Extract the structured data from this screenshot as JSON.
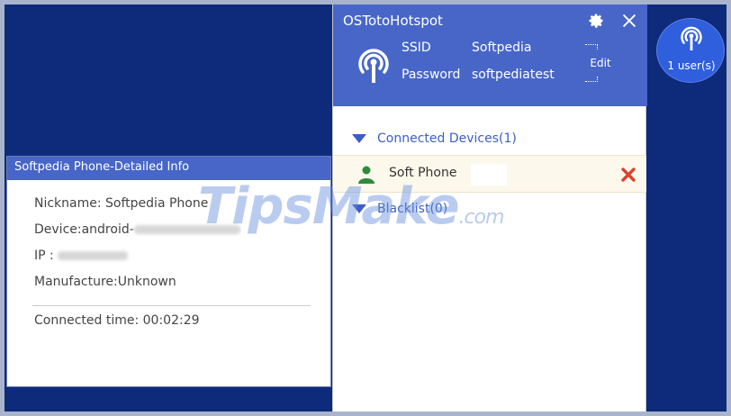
{
  "hotspot": {
    "title": "OSTotoHotspot",
    "ssid_label": "SSID",
    "ssid_value": "Softpedia",
    "password_label": "Password",
    "password_value": "softpediatest",
    "edit_label": "Edit",
    "icons": {
      "settings": "gear-icon",
      "close": "close-icon",
      "hotspot": "hotspot-icon"
    }
  },
  "devices_section": {
    "header": "Connected Devices(1)",
    "devices": [
      {
        "name": "Soft Phone",
        "status_color": "#2e8b3a"
      }
    ]
  },
  "blacklist_section": {
    "header": "Blacklist(0)"
  },
  "users_badge": {
    "label": "1 user(s)"
  },
  "detail": {
    "title": "Softpedia Phone-Detailed Info",
    "nickname": "Nickname:  Softpedia Phone",
    "device_prefix": "Device:android-",
    "ip_prefix": "IP   :",
    "manufacture": "Manufacture:Unknown",
    "connected_time": "Connected time: 00:02:29"
  },
  "watermark": {
    "main": "TipsMake",
    "suffix": ".com"
  },
  "colors": {
    "accent": "#4766c8",
    "background": "#0e2a7a",
    "remove": "#d9432f",
    "link": "#3d5fc4"
  }
}
